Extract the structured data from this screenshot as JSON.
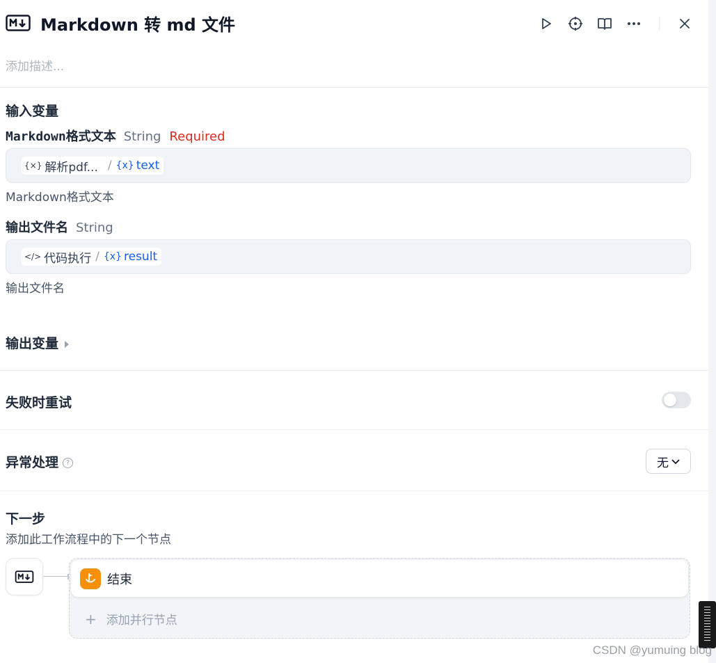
{
  "header": {
    "icon": "markdown-icon",
    "title": "Markdown 转 md 文件",
    "tools": [
      "play-icon",
      "crosshair-icon",
      "book-icon",
      "more-icon",
      "close-icon"
    ]
  },
  "description_placeholder": "添加描述...",
  "input_section": {
    "title": "输入变量",
    "fields": [
      {
        "name": "Markdown格式文本",
        "type": "String",
        "required": "Required",
        "source_node": "解析pdf...",
        "source_var": "text",
        "hint": "Markdown格式文本"
      },
      {
        "name": "输出文件名",
        "type": "String",
        "source_node": "代码执行",
        "source_var": "result",
        "hint": "输出文件名"
      }
    ]
  },
  "output_section": {
    "title": "输出变量"
  },
  "retry": {
    "title": "失败时重试",
    "enabled": false
  },
  "error_handling": {
    "title": "异常处理",
    "value": "无",
    "help": "?"
  },
  "next_step": {
    "title": "下一步",
    "subtitle": "添加此工作流程中的下一个节点",
    "node_label": "结束",
    "add_parallel": "添加并行节点",
    "plus": "+"
  },
  "watermark": "CSDN @yumuing blog",
  "colors": {
    "accent": "#155eef",
    "required": "#d92d20",
    "end_node": "#f79009"
  }
}
